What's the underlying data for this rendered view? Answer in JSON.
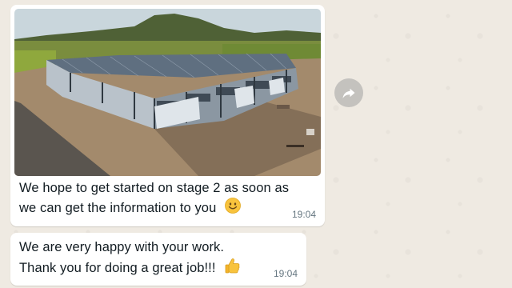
{
  "chat": {
    "messages": [
      {
        "image": {
          "subject": "aerial-photo-steel-frame-building-under-construction"
        },
        "lines": [
          "We hope to get started on stage 2 as soon as",
          "we can get the information to you"
        ],
        "emoji": "smiling-face",
        "time": "19:04"
      },
      {
        "lines": [
          "We are very happy with your work.",
          "Thank you for doing a great job!!!"
        ],
        "emoji": "thumbs-up",
        "time": "19:04"
      }
    ],
    "forward_icon": "share-forward-icon",
    "colors": {
      "wallpaper": "#efeae2",
      "bubble": "#ffffff",
      "text": "#111b21",
      "timestamp": "#667781"
    }
  }
}
